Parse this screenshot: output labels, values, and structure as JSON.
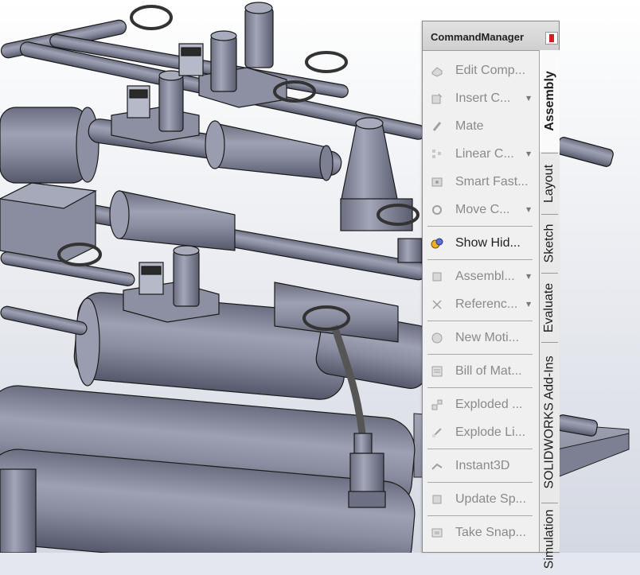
{
  "command_manager": {
    "title": "CommandManager",
    "items": [
      {
        "label": "Edit Comp...",
        "icon": "edit-component-icon",
        "dropdown": false,
        "active": false
      },
      {
        "label": "Insert C...",
        "icon": "insert-components-icon",
        "dropdown": true,
        "active": false
      },
      {
        "label": "Mate",
        "icon": "mate-icon",
        "dropdown": false,
        "active": false
      },
      {
        "label": "Linear C...",
        "icon": "linear-pattern-icon",
        "dropdown": true,
        "active": false
      },
      {
        "label": "Smart Fast...",
        "icon": "smart-fasteners-icon",
        "dropdown": false,
        "active": false
      },
      {
        "label": "Move C...",
        "icon": "move-component-icon",
        "dropdown": true,
        "active": false
      },
      {
        "label": "Show Hid...",
        "icon": "show-hidden-icon",
        "dropdown": false,
        "active": true
      },
      {
        "label": "Assembl...",
        "icon": "assembly-features-icon",
        "dropdown": true,
        "active": false
      },
      {
        "label": "Referenc...",
        "icon": "reference-geometry-icon",
        "dropdown": true,
        "active": false
      },
      {
        "label": "New Moti...",
        "icon": "new-motion-study-icon",
        "dropdown": false,
        "active": false
      },
      {
        "label": "Bill of Mat...",
        "icon": "bill-of-materials-icon",
        "dropdown": false,
        "active": false
      },
      {
        "label": "Exploded ...",
        "icon": "exploded-view-icon",
        "dropdown": false,
        "active": false
      },
      {
        "label": "Explode Li...",
        "icon": "explode-line-icon",
        "dropdown": false,
        "active": false
      },
      {
        "label": "Instant3D",
        "icon": "instant3d-icon",
        "dropdown": false,
        "active": false
      },
      {
        "label": "Update Sp...",
        "icon": "update-speedpak-icon",
        "dropdown": false,
        "active": false
      },
      {
        "label": "Take Snap...",
        "icon": "take-snapshot-icon",
        "dropdown": false,
        "active": false
      }
    ],
    "tabs": [
      {
        "label": "Assembly",
        "active": true
      },
      {
        "label": "Layout",
        "active": false
      },
      {
        "label": "Sketch",
        "active": false
      },
      {
        "label": "Evaluate",
        "active": false
      },
      {
        "label": "SOLIDWORKS Add-Ins",
        "active": false
      },
      {
        "label": "Simulation",
        "active": false
      }
    ]
  }
}
